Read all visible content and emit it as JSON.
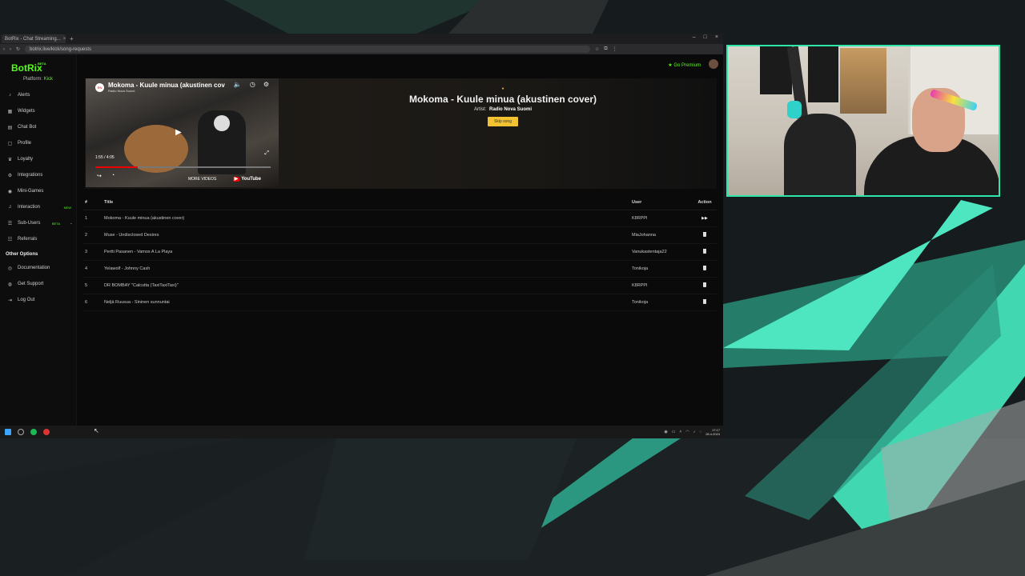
{
  "browser": {
    "tab_title": "BotRix - Chat Streaming...",
    "tab_close": "×",
    "new_tab": "+",
    "url": "botrix.live/kick/song-requests",
    "window_controls": [
      "–",
      "□",
      "×"
    ]
  },
  "sidebar": {
    "brand": "BotRix",
    "beta": "BETA",
    "platform_label": "Platform:",
    "platform_value": "Kick",
    "items": [
      {
        "label": "Alerts",
        "icon": "bell-icon"
      },
      {
        "label": "Widgets",
        "icon": "widgets-icon"
      },
      {
        "label": "Chat Bot",
        "icon": "chat-icon"
      },
      {
        "label": "Profile",
        "icon": "profile-icon"
      },
      {
        "label": "Loyalty",
        "icon": "trophy-icon"
      },
      {
        "label": "Integrations",
        "icon": "integrations-icon"
      },
      {
        "label": "Mini-Games",
        "icon": "gamepad-icon"
      },
      {
        "label": "Interaction",
        "icon": "music-icon",
        "badge": "NEW"
      },
      {
        "label": "Sub-Users",
        "icon": "users-icon",
        "badge": "BETA"
      },
      {
        "label": "Referrals",
        "icon": "referrals-icon"
      }
    ],
    "other_title": "Other Options",
    "other_items": [
      {
        "label": "Documentation",
        "icon": "doc-icon"
      },
      {
        "label": "Get Support",
        "icon": "support-icon"
      },
      {
        "label": "Log Out",
        "icon": "logout-icon"
      }
    ]
  },
  "topbar": {
    "premium": "Go Premium"
  },
  "video": {
    "title": "Mokoma - Kuule minua (akustinen cov",
    "channel": "Radio Nova Suomi",
    "time": "1:55 / 4:05",
    "more_videos": "MORE VIDEOS",
    "brand": "YouTube"
  },
  "now_playing": {
    "title": "Mokoma - Kuule minua (akustinen cover)",
    "artist_label": "Artist:",
    "artist": "Radio Nova Suomi",
    "skip": "Skip song",
    "progress": 0.24
  },
  "queue": {
    "headers": {
      "num": "#",
      "title": "Title",
      "user": "User",
      "action": "Action"
    },
    "rows": [
      {
        "num": "1",
        "title": "Mokoma - Kuule minua (akustinen cover)",
        "user": "K8RPPI",
        "action": "play"
      },
      {
        "num": "2",
        "title": "Muse - Undisclosed Desires",
        "user": "MiaJohanna",
        "action": "delete"
      },
      {
        "num": "3",
        "title": "Pertti Pasanen - Vamos A La Playa",
        "user": "Vanukastentaja22",
        "action": "delete"
      },
      {
        "num": "4",
        "title": "Yelawolf - Johnny Cash",
        "user": "Tonikoja",
        "action": "delete"
      },
      {
        "num": "5",
        "title": "DR BOMBAY \"Calcutta (TaxiTaxiTaxi)\"",
        "user": "K8RPPI",
        "action": "delete"
      },
      {
        "num": "6",
        "title": "Neljä Ruusua - Sininen sunnuntai",
        "user": "Tonikoja",
        "action": "delete"
      }
    ]
  },
  "taskbar": {
    "time": "17:17",
    "date": "28.4.2024"
  }
}
